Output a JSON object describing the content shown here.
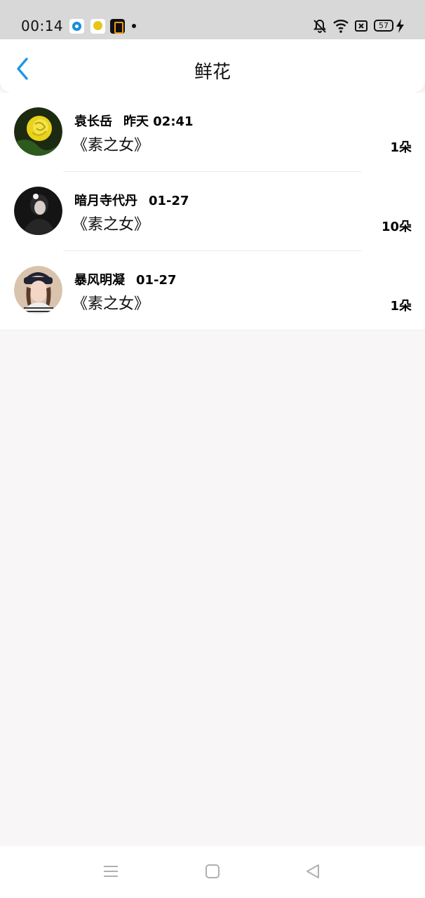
{
  "status_bar": {
    "time": "00:14",
    "battery": "57",
    "icons": [
      "app-icon-blue",
      "app-icon-yellow",
      "app-icon-black",
      "bell-off-icon",
      "wifi-icon",
      "sim-x-icon",
      "battery-icon",
      "charging-bolt-icon"
    ]
  },
  "header": {
    "title": "鲜花",
    "back_icon": "chevron-left-icon",
    "accent": "#1e96e6"
  },
  "items": [
    {
      "name": "袁长岳",
      "time": "昨天 02:41",
      "book": "《素之女》",
      "count": "1朵",
      "avatar": "yellow-rose"
    },
    {
      "name": "暗月寺代丹",
      "time": "01-27",
      "book": "《素之女》",
      "count": "10朵",
      "avatar": "dark-portrait"
    },
    {
      "name": "暴风明凝",
      "time": "01-27",
      "book": "《素之女》",
      "count": "1朵",
      "avatar": "girl-with-cap"
    }
  ],
  "bottom_nav": {
    "icons": [
      "menu-icon",
      "home-square-icon",
      "back-triangle-icon"
    ]
  }
}
